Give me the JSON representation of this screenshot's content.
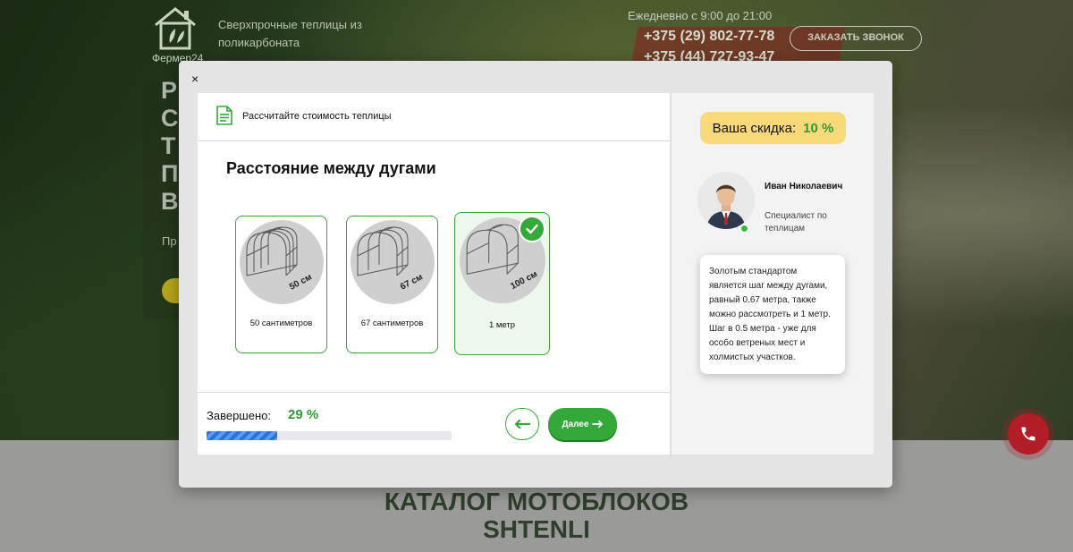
{
  "background": {
    "logo_text": "Фермер24",
    "tagline": "Сверхпрочные теплицы из поликарбоната",
    "hours": "Ежедневно с 9:00 до 21:00",
    "phone_1": "+375 (29) 802-77-78",
    "phone_2": "+375 (44) 727-93-47",
    "callback_button": "ЗАКАЗАТЬ ЗВОНОК",
    "hero_letters": [
      "Р",
      "С",
      "Т",
      "П",
      "В"
    ],
    "hero_small": "Пр",
    "catalog_title_line1": "КАТАЛОГ МОТОБЛОКОВ",
    "catalog_title_line2": "SHTENLI"
  },
  "modal": {
    "close_label": "×",
    "header_title": "Рассчитайте стоимость теплицы",
    "question": "Расстояние между дугами",
    "options": [
      {
        "label": "50 сантиметров",
        "size_tag": "50 см",
        "selected": false
      },
      {
        "label": "67 сантиметров",
        "size_tag": "67 см",
        "selected": false
      },
      {
        "label": "1 метр",
        "size_tag": "100 см",
        "selected": true
      }
    ],
    "progress": {
      "label": "Завершено:",
      "value_text": "29 %",
      "percent": 29
    },
    "next_button": "Далее"
  },
  "sidebar": {
    "discount_label": "Ваша скидка:",
    "discount_value": "10 %",
    "consultant_name": "Иван Николаевич",
    "consultant_role": "Специалист по теплицам",
    "tip": "Золотым стандартом является шаг между дугами, равный 0.67 метра, также можно рассмотреть и 1 метр. Шаг в 0.5 метра - уже для особо ветреных мест и холмистых участков."
  },
  "colors": {
    "accent_green": "#35a83a",
    "discount_bg": "#fad97a",
    "progress_blue": "#2b73d6",
    "call_red": "#b31d27"
  },
  "icons": [
    "house-leaf-logo-icon",
    "document-icon",
    "greenhouse-icon",
    "check-icon",
    "arrow-left-icon",
    "arrow-right-icon",
    "phone-icon",
    "close-icon"
  ]
}
